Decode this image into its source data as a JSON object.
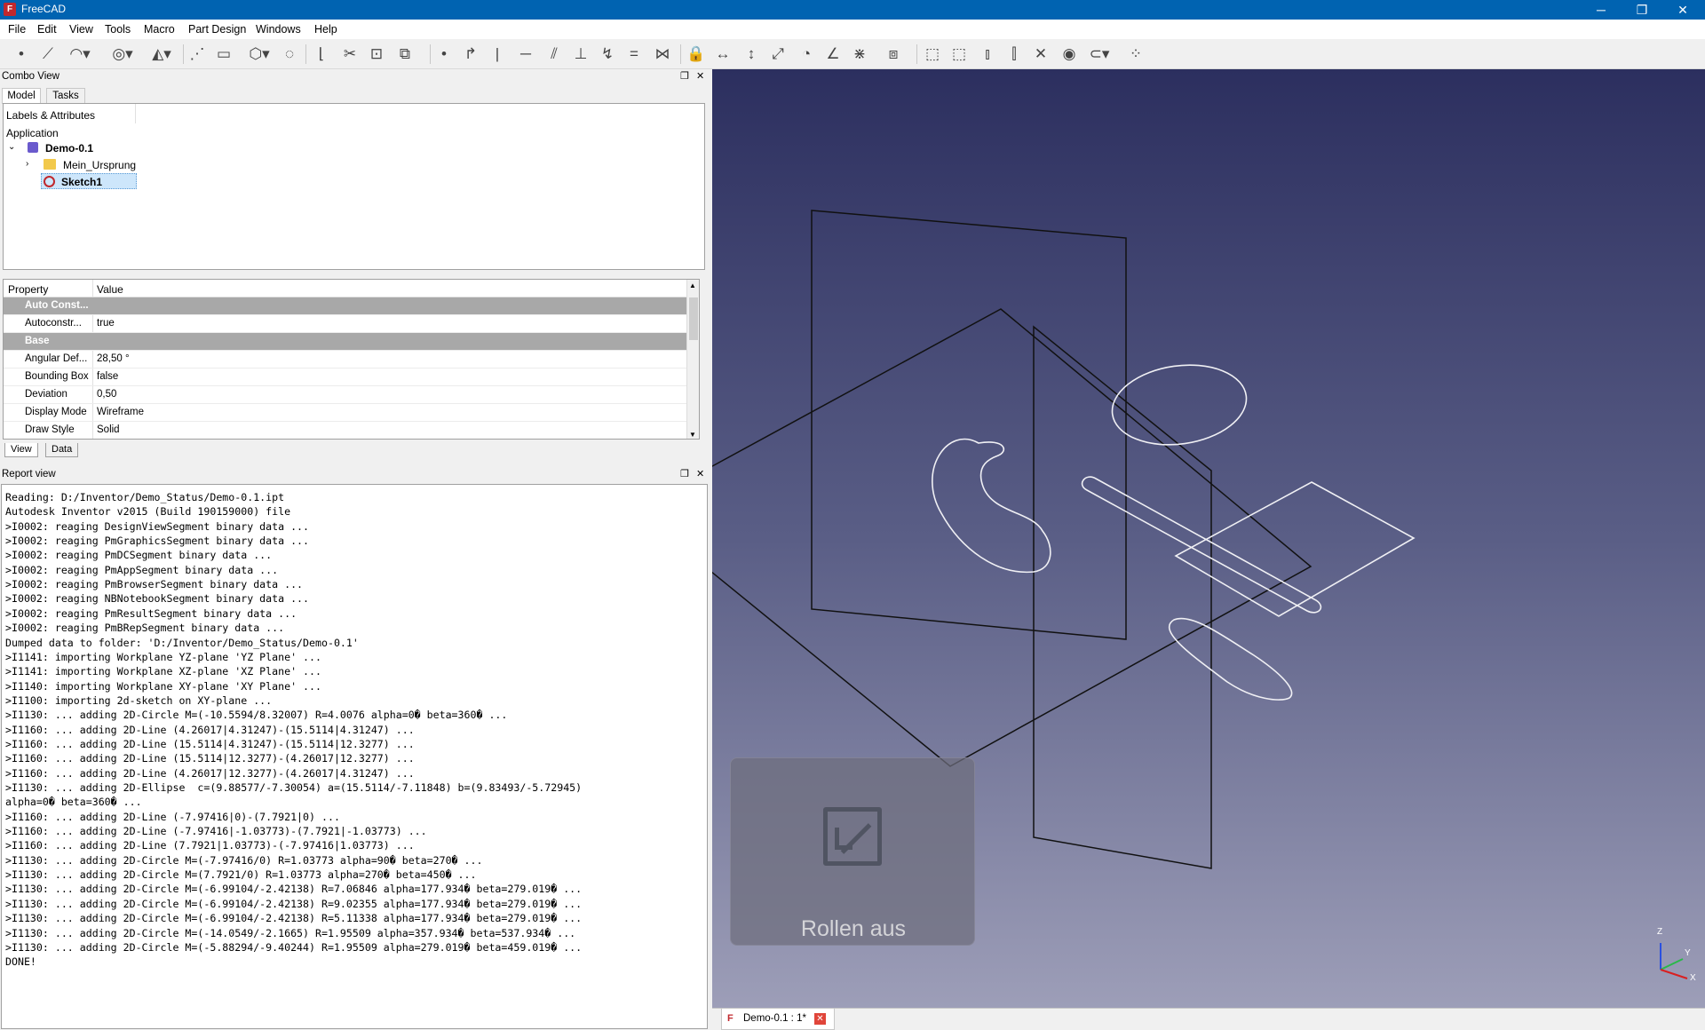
{
  "window": {
    "title": "FreeCAD",
    "minimize": "─",
    "restore": "❐",
    "close": "✕"
  },
  "menu": [
    "File",
    "Edit",
    "View",
    "Tools",
    "Macro",
    "Part Design",
    "Windows",
    "Help"
  ],
  "combo": {
    "title": "Combo View",
    "tabs": [
      "Model",
      "Tasks"
    ],
    "float_icon": "❐",
    "close_icon": "✕"
  },
  "tree": {
    "header": "Labels & Attributes",
    "application": "Application",
    "doc": "Demo-0.1",
    "folder": "Mein_Ursprung",
    "sketch": "Sketch1"
  },
  "props": {
    "col_property": "Property",
    "col_value": "Value",
    "rows": [
      {
        "name": "Auto Const...",
        "value": "",
        "group": true
      },
      {
        "name": "Autoconstr...",
        "value": "true"
      },
      {
        "name": "Base",
        "value": "",
        "group": true
      },
      {
        "name": "Angular Def...",
        "value": "28,50 °"
      },
      {
        "name": "Bounding Box",
        "value": "false"
      },
      {
        "name": "Deviation",
        "value": "0,50"
      },
      {
        "name": "Display Mode",
        "value": "Wireframe"
      },
      {
        "name": "Draw Style",
        "value": "Solid"
      }
    ],
    "tabs": [
      "View",
      "Data"
    ]
  },
  "report": {
    "title": "Report view",
    "lines": [
      "Reading: D:/Inventor/Demo_Status/Demo-0.1.ipt",
      "Autodesk Inventor v2015 (Build 190159000) file",
      ">I0002: reaging DesignViewSegment binary data ...",
      ">I0002: reaging PmGraphicsSegment binary data ...",
      ">I0002: reaging PmDCSegment binary data ...",
      ">I0002: reaging PmAppSegment binary data ...",
      ">I0002: reaging PmBrowserSegment binary data ...",
      ">I0002: reaging NBNotebookSegment binary data ...",
      ">I0002: reaging PmResultSegment binary data ...",
      ">I0002: reaging PmBRepSegment binary data ...",
      "Dumped data to folder: 'D:/Inventor/Demo_Status/Demo-0.1'",
      ">I1141: importing Workplane YZ-plane 'YZ Plane' ...",
      ">I1141: importing Workplane XZ-plane 'XZ Plane' ...",
      ">I1140: importing Workplane XY-plane 'XY Plane' ...",
      ">I1100: importing 2d-sketch on XY-plane ...",
      ">I1130: ... adding 2D-Circle M=(-10.5594/8.32007) R=4.0076 alpha=0� beta=360� ...",
      ">I1160: ... adding 2D-Line (4.26017|4.31247)-(15.5114|4.31247) ...",
      ">I1160: ... adding 2D-Line (15.5114|4.31247)-(15.5114|12.3277) ...",
      ">I1160: ... adding 2D-Line (15.5114|12.3277)-(4.26017|12.3277) ...",
      ">I1160: ... adding 2D-Line (4.26017|12.3277)-(4.26017|4.31247) ...",
      ">I1130: ... adding 2D-Ellipse  c=(9.88577/-7.30054) a=(15.5114/-7.11848) b=(9.83493/-5.72945)",
      "alpha=0� beta=360� ...",
      ">I1160: ... adding 2D-Line (-7.97416|0)-(7.7921|0) ...",
      ">I1160: ... adding 2D-Line (-7.97416|-1.03773)-(7.7921|-1.03773) ...",
      ">I1160: ... adding 2D-Line (7.7921|1.03773)-(-7.97416|1.03773) ...",
      ">I1130: ... adding 2D-Circle M=(-7.97416/0) R=1.03773 alpha=90� beta=270� ...",
      ">I1130: ... adding 2D-Circle M=(7.7921/0) R=1.03773 alpha=270� beta=450� ...",
      ">I1130: ... adding 2D-Circle M=(-6.99104/-2.42138) R=7.06846 alpha=177.934� beta=279.019� ...",
      ">I1130: ... adding 2D-Circle M=(-6.99104/-2.42138) R=9.02355 alpha=177.934� beta=279.019� ...",
      ">I1130: ... adding 2D-Circle M=(-6.99104/-2.42138) R=5.11338 alpha=177.934� beta=279.019� ...",
      ">I1130: ... adding 2D-Circle M=(-14.0549/-2.1665) R=1.95509 alpha=357.934� beta=537.934� ...",
      ">I1130: ... adding 2D-Circle M=(-5.88294/-9.40244) R=1.95509 alpha=279.019� beta=459.019� ...",
      "DONE!"
    ]
  },
  "viewport": {
    "notification": "Rollen aus",
    "axes": {
      "z": "Z",
      "y": "Y",
      "x": "X"
    }
  },
  "doc_tab": {
    "label": "Demo-0.1 : 1*"
  }
}
